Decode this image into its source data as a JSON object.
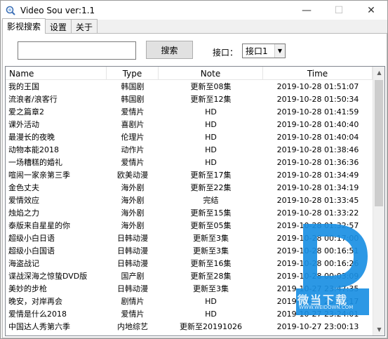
{
  "window": {
    "title": "Video Sou  ver:1.1",
    "minimize": "—",
    "maximize": "☐",
    "close": "✕"
  },
  "tabs": [
    {
      "label": "影视搜索"
    },
    {
      "label": "设置"
    },
    {
      "label": "关于"
    }
  ],
  "search": {
    "value": "",
    "button_label": "搜索",
    "api_label": "接口：",
    "api_selected": "接口1"
  },
  "table": {
    "columns": [
      "Name",
      "Type",
      "Note",
      "Time"
    ],
    "rows": [
      {
        "name": "我的王国",
        "type": "韩国剧",
        "note": "更新至08集",
        "time": "2019-10-28 01:51:07"
      },
      {
        "name": "流浪者/浪客行",
        "type": "韩国剧",
        "note": "更新至12集",
        "time": "2019-10-28 01:50:34"
      },
      {
        "name": "爱之篇章2",
        "type": "爱情片",
        "note": "HD",
        "time": "2019-10-28 01:41:59"
      },
      {
        "name": "课外活动",
        "type": "喜剧片",
        "note": "HD",
        "time": "2019-10-28 01:40:40"
      },
      {
        "name": "最漫长的夜晚",
        "type": "伦理片",
        "note": "HD",
        "time": "2019-10-28 01:40:04"
      },
      {
        "name": "动物本能2018",
        "type": "动作片",
        "note": "HD",
        "time": "2019-10-28 01:38:46"
      },
      {
        "name": "一场糟糕的婚礼",
        "type": "爱情片",
        "note": "HD",
        "time": "2019-10-28 01:36:36"
      },
      {
        "name": "喧闹一家亲第三季",
        "type": "欧美动漫",
        "note": "更新至17集",
        "time": "2019-10-28 01:34:49"
      },
      {
        "name": "金色丈夫",
        "type": "海外剧",
        "note": "更新至22集",
        "time": "2019-10-28 01:34:19"
      },
      {
        "name": "爱情效应",
        "type": "海外剧",
        "note": "完结",
        "time": "2019-10-28 01:33:45"
      },
      {
        "name": "烛焰之力",
        "type": "海外剧",
        "note": "更新至15集",
        "time": "2019-10-28 01:33:22"
      },
      {
        "name": "泰版来自星星的你",
        "type": "海外剧",
        "note": "更新至05集",
        "time": "2019-10-28 01:32:57"
      },
      {
        "name": "超级小白日语",
        "type": "日韩动漫",
        "note": "更新至3集",
        "time": "2019-10-28 00:17:00"
      },
      {
        "name": "超级小白国语",
        "type": "日韩动漫",
        "note": "更新至3集",
        "time": "2019-10-28 00:16:51"
      },
      {
        "name": "海盗战记",
        "type": "日韩动漫",
        "note": "更新至16集",
        "time": "2019-10-28 00:16:26"
      },
      {
        "name": "谍战深海之惊蛰DVD版",
        "type": "国产剧",
        "note": "更新至28集",
        "time": "2019-10-28 00:03:09"
      },
      {
        "name": "美妙的步枪",
        "type": "日韩动漫",
        "note": "更新至3集",
        "time": "2019-10-27 23:47:35"
      },
      {
        "name": "晚安，对岸再会",
        "type": "剧情片",
        "note": "HD",
        "time": "2019-10-27 23:26:17"
      },
      {
        "name": "爱情是什么2018",
        "type": "爱情片",
        "note": "HD",
        "time": "2019-10-27 23:24:01"
      },
      {
        "name": "中国达人秀第六季",
        "type": "内地综艺",
        "note": "更新至20191026",
        "time": "2019-10-27 23:00:13"
      }
    ]
  },
  "watermark": {
    "text": "微当下载",
    "url": "WWW.WEIDOWN.COM"
  },
  "colors": {
    "watermark_blue": "#1a8fe3",
    "selected_tab_bg": "#ffffff",
    "window_bg": "#f0f0f0"
  }
}
